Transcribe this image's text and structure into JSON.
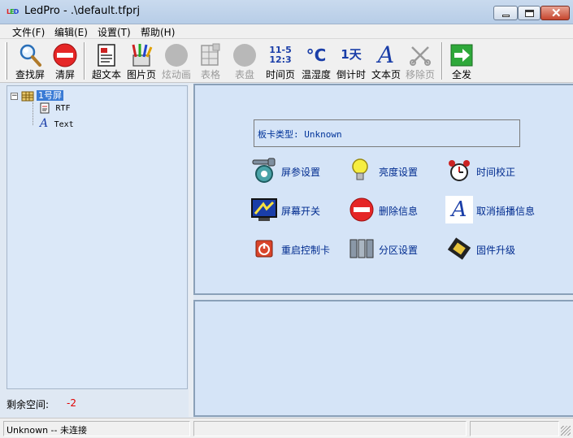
{
  "window": {
    "title": "LedPro - .\\default.tfprj",
    "icon_text": [
      "L",
      "E",
      "D"
    ]
  },
  "menu": [
    "文件(F)",
    "编辑(E)",
    "设置(T)",
    "帮助(H)"
  ],
  "toolbar": {
    "find_screen": "查找屏",
    "clear_screen": "清屏",
    "super_text": "超文本",
    "picture_page": "图片页",
    "animation": "炫动画",
    "table": "表格",
    "clock_dial": "表盘",
    "time_page": "时间页",
    "time_icon_text": "11-5\n12:3",
    "temp_humidity": "温湿度",
    "temp_icon_text": "°C",
    "countdown": "倒计时",
    "countdown_icon_text": "1天",
    "text_page": "文本页",
    "text_icon_text": "A",
    "remove_page": "移除页",
    "send_all": "全发"
  },
  "tree": {
    "root": "1号屏",
    "children": [
      "RTF",
      "Text"
    ]
  },
  "left_footer": {
    "label": "剩余空间:",
    "value": "-2"
  },
  "panel": {
    "card_type": "板卡类型: Unknown",
    "actions": {
      "screen_params": "屏参设置",
      "brightness": "亮度设置",
      "time_calibrate": "时间校正",
      "screen_switch": "屏幕开关",
      "delete_info": "删除信息",
      "cancel_insert": "取消插播信息",
      "restart_controller": "重启控制卡",
      "partition": "分区设置",
      "firmware": "固件升级"
    }
  },
  "status": {
    "connection": "Unknown -- 未连接"
  },
  "colors": {
    "accent": "#3a7bd5",
    "panel_bg": "#d5e4f7",
    "action_text": "#002b8f",
    "warning": "#e00000"
  }
}
